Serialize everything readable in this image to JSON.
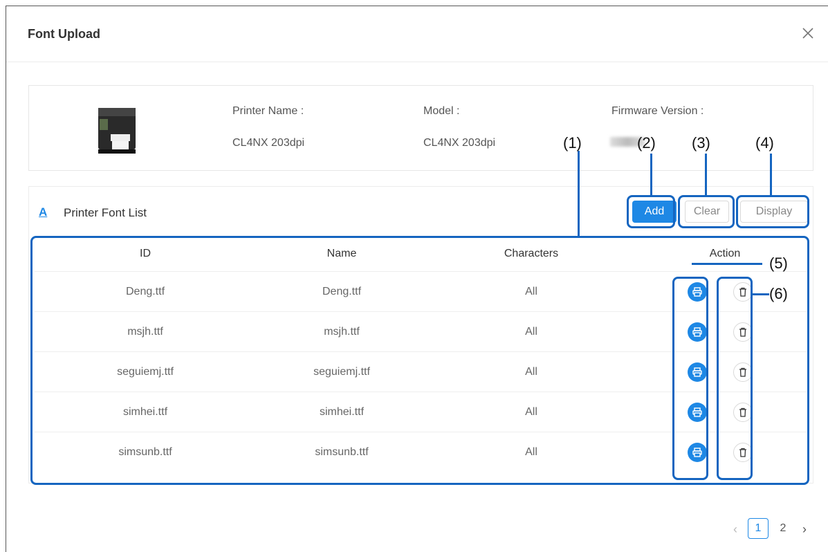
{
  "dialog": {
    "title": "Font Upload",
    "close_icon": "close-icon"
  },
  "printer": {
    "name_label": "Printer Name :",
    "name_value": "CL4NX 203dpi",
    "model_label": "Model :",
    "model_value": "CL4NX 203dpi",
    "firmware_label": "Firmware Version :"
  },
  "font_list": {
    "header_icon_text": "A",
    "title": "Printer Font List",
    "add_label": "Add",
    "clear_label": "Clear",
    "display_label": "Display",
    "columns": [
      "ID",
      "Name",
      "Characters",
      "Action"
    ],
    "rows": [
      {
        "id": "Deng.ttf",
        "name": "Deng.ttf",
        "characters": "All"
      },
      {
        "id": "msjh.ttf",
        "name": "msjh.ttf",
        "characters": "All"
      },
      {
        "id": "seguiemj.ttf",
        "name": "seguiemj.ttf",
        "characters": "All"
      },
      {
        "id": "simhei.ttf",
        "name": "simhei.ttf",
        "characters": "All"
      },
      {
        "id": "simsunb.ttf",
        "name": "simsunb.ttf",
        "characters": "All"
      }
    ]
  },
  "callouts": [
    "(1)",
    "(2)",
    "(3)",
    "(4)",
    "(5)",
    "(6)"
  ],
  "pagination": {
    "prev_icon": "chevron-left-icon",
    "pages": [
      "1",
      "2"
    ],
    "current": "1",
    "next_icon": "chevron-right-icon"
  },
  "colors": {
    "accent": "#1e88e5",
    "annotation": "#1565c0"
  }
}
